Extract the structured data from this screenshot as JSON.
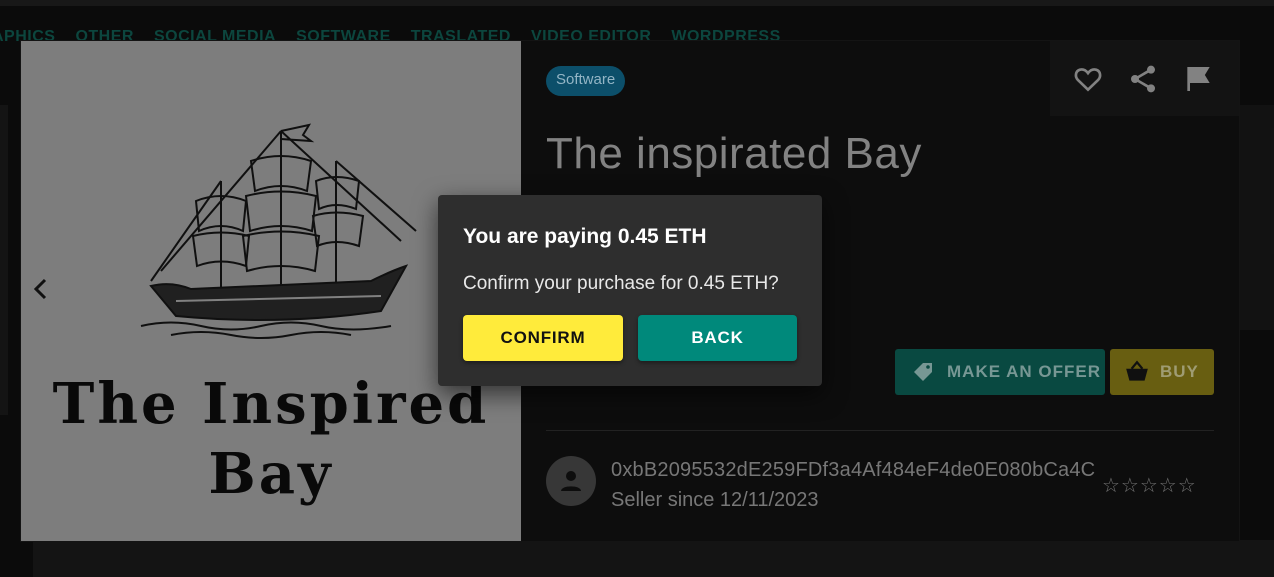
{
  "categories_nav": [
    "APHICS",
    "OTHER",
    "SOCIAL MEDIA",
    "SOFTWARE",
    "TRASLATED",
    "VIDEO EDITOR",
    "WORDPRESS"
  ],
  "product": {
    "category_chip": "Software",
    "title": "The inspirated Bay",
    "image": {
      "logo_line1": "The Inspired",
      "logo_line2": "Bay",
      "icon": "ship-illustration"
    },
    "prev_icon": "chevron-left-icon",
    "actions": [
      {
        "name": "favorite",
        "icon": "heart-outline-icon"
      },
      {
        "name": "share",
        "icon": "share-icon"
      },
      {
        "name": "report",
        "icon": "flag-icon"
      }
    ],
    "make_offer_label": "MAKE AN OFFER",
    "buy_label": "BUY",
    "seller": {
      "address": "0xbB2095532dE259FDf3a4Af484eF4de0E080bCa4C",
      "since": "Seller since 12/11/2023",
      "rating_stars": "☆☆☆☆☆",
      "rating": 0
    }
  },
  "dialog": {
    "title": "You are paying 0.45 ETH",
    "message": "Confirm your purchase for 0.45 ETH?",
    "confirm_label": "CONFIRM",
    "back_label": "BACK"
  },
  "colors": {
    "confirm": "#ffeb3b",
    "back": "#00897b",
    "chip": "#0d5470",
    "dialog_bg": "#2e2e2e"
  }
}
